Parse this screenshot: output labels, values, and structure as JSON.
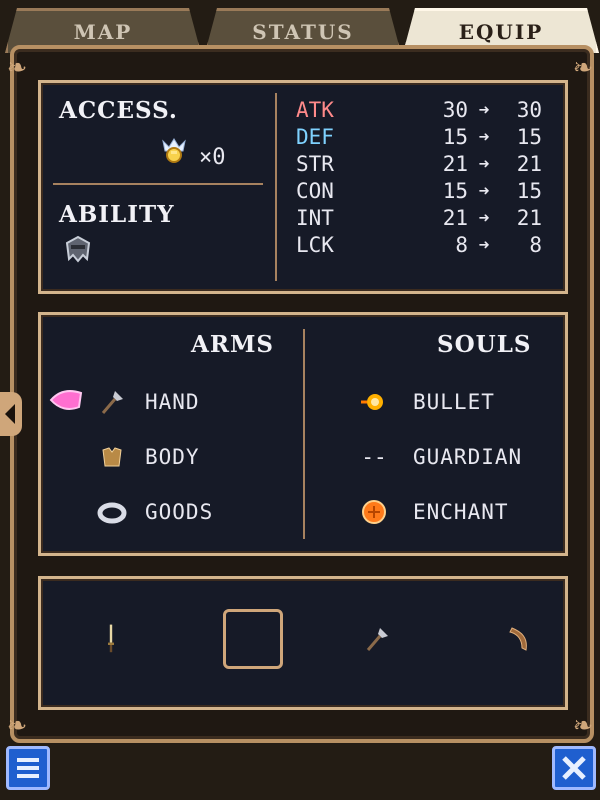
{
  "tabs": {
    "items": [
      {
        "label": "MAP"
      },
      {
        "label": "STATUS"
      },
      {
        "label": "EQUIP"
      }
    ],
    "active": "EQUIP"
  },
  "summary": {
    "access_label": "ACCESS.",
    "access_count": "×0",
    "ability_label": "ABILITY",
    "stats": [
      {
        "name": "ATK",
        "from": "30",
        "to": "30",
        "color": "#ff8a8a"
      },
      {
        "name": "DEF",
        "from": "15",
        "to": "15",
        "color": "#7fd2ff"
      },
      {
        "name": "STR",
        "from": "21",
        "to": "21"
      },
      {
        "name": "CON",
        "from": "15",
        "to": "15"
      },
      {
        "name": "INT",
        "from": "21",
        "to": "21"
      },
      {
        "name": "LCK",
        "from": "8",
        "to": "8"
      }
    ]
  },
  "equipment": {
    "arms_header": "ARMS",
    "souls_header": "SOULS",
    "arms": [
      {
        "label": "HAND",
        "icon": "axe-icon"
      },
      {
        "label": "BODY",
        "icon": "armor-icon"
      },
      {
        "label": "GOODS",
        "icon": "ring-icon"
      }
    ],
    "souls": [
      {
        "label": "BULLET",
        "icon": "bullet-soul-icon"
      },
      {
        "label": "GUARDIAN",
        "icon": "--"
      },
      {
        "label": "ENCHANT",
        "icon": "enchant-soul-icon"
      }
    ]
  },
  "quick_slots": [
    {
      "icon": "dagger-icon"
    },
    {
      "icon": "empty-slot"
    },
    {
      "icon": "axe-icon"
    },
    {
      "icon": "boomerang-icon"
    }
  ],
  "colors": {
    "panel_border": "#d3b48c",
    "panel_bg": "#161a27",
    "tab_active": "#ede6d4",
    "tab_inactive": "#5a4f3c",
    "button_blue": "#1f5fcf"
  }
}
